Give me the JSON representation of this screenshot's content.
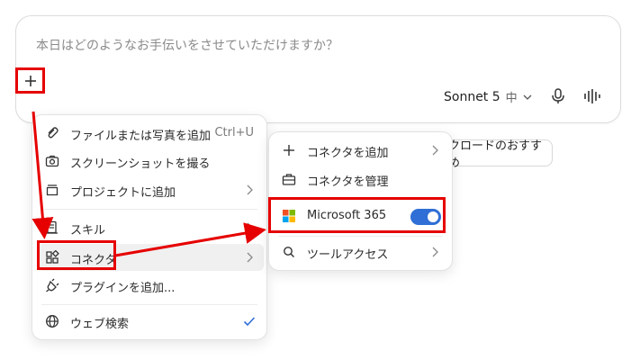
{
  "composer": {
    "placeholder": "本日はどのようなお手伝いをさせていただけますか？",
    "model_name": "Sonnet 5",
    "model_level": "中",
    "add_icon": "plus-icon",
    "mic_icon": "microphone-icon",
    "voice_icon": "waveform-icon"
  },
  "menu": {
    "items": [
      {
        "label": "ファイルまたは写真を追加",
        "shortcut": "Ctrl+U",
        "icon": "paperclip-icon"
      },
      {
        "label": "スクリーンショットを撮る",
        "icon": "camera-icon"
      },
      {
        "label": "プロジェクトに追加",
        "icon": "folder-icon",
        "has_submenu": true
      },
      {
        "label": "スキル",
        "icon": "skill-icon",
        "has_submenu": true
      },
      {
        "label": "コネクタ",
        "icon": "connector-icon",
        "has_submenu": true,
        "highlighted": true
      },
      {
        "label": "プラグインを追加...",
        "icon": "plug-icon"
      },
      {
        "label": "ウェブ検索",
        "icon": "globe-icon",
        "checked": true
      }
    ]
  },
  "submenu": {
    "items": [
      {
        "label": "コネクタを追加",
        "icon": "plus-icon",
        "has_submenu": true
      },
      {
        "label": "コネクタを管理",
        "icon": "toolbox-icon"
      },
      {
        "label": "Microsoft 365",
        "icon": "microsoft-logo-icon",
        "toggle_on": true
      },
      {
        "label": "ツールアクセス",
        "icon": "search-icon",
        "has_submenu": true
      }
    ]
  },
  "chip": {
    "label": "クロードのおすすめ"
  },
  "colors": {
    "annotation": "#e60000",
    "toggle": "#2f6fd6",
    "check": "#2f6fd6"
  }
}
